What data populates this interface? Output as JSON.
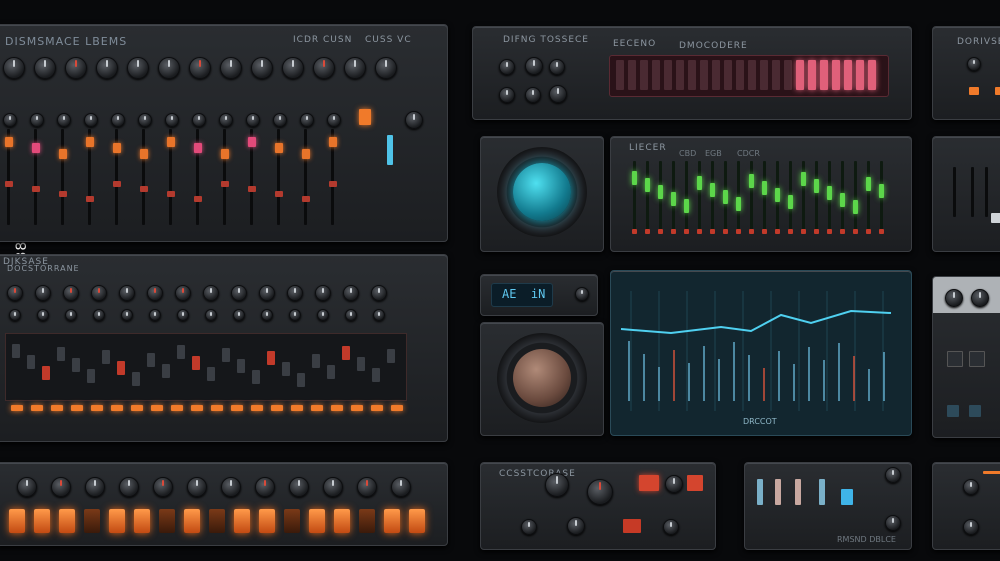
{
  "stock_id": "1118173826",
  "panels": {
    "mixer_top": {
      "title": "DISMSMACE LBEMS",
      "sub": "ICDR CUSN",
      "tag": "CUSS VC"
    },
    "eq_top": {
      "title": "DIFNG TOSSECE",
      "sub": "EECENO",
      "tag": "DMOCODERE"
    },
    "right_top": {
      "title": "DORIVSE BAE"
    },
    "green_eq": {
      "title": "LIECER",
      "labels": [
        "CBD",
        "EGB",
        "CDCR"
      ]
    },
    "mid_left": {
      "title": "DJKSASE",
      "sub": "DOCSTORRANE"
    },
    "lcd": {
      "text": "AE  iN"
    },
    "scope": {
      "label": "DRCCOT"
    },
    "bottom_mid": {
      "title": "CCSSTCORASE"
    },
    "bottom_right": {
      "label": "RMSND DBLCE"
    }
  }
}
